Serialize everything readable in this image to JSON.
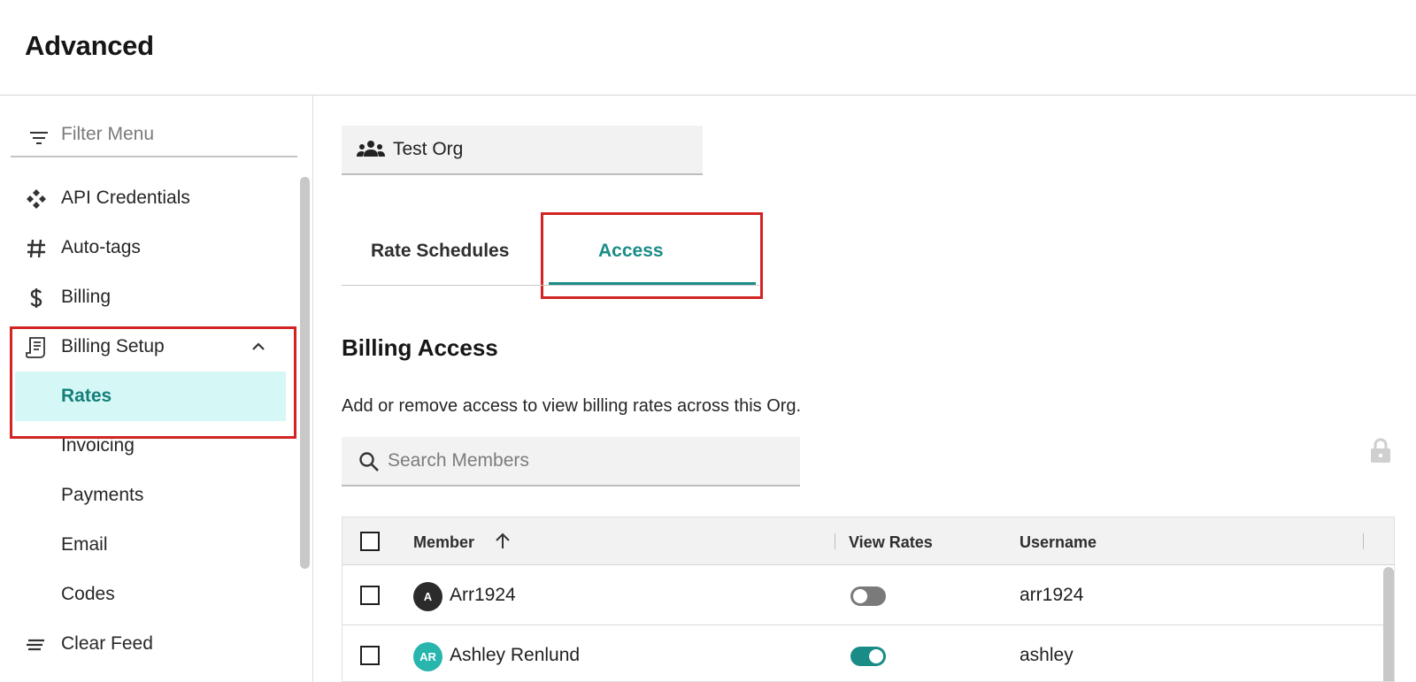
{
  "header": {
    "title": "Advanced"
  },
  "sidebar": {
    "filter_placeholder": "Filter Menu",
    "items": [
      {
        "label": "API Credentials",
        "icon": "api-icon"
      },
      {
        "label": "Auto-tags",
        "icon": "hashtag-icon"
      },
      {
        "label": "Billing",
        "icon": "dollar-icon"
      },
      {
        "label": "Billing Setup",
        "icon": "receipt-icon",
        "expanded": true
      }
    ],
    "sub_items": [
      {
        "label": "Rates",
        "active": true
      },
      {
        "label": "Invoicing"
      },
      {
        "label": "Payments"
      },
      {
        "label": "Email"
      },
      {
        "label": "Codes"
      }
    ],
    "bottom_item": {
      "label": "Clear Feed",
      "icon": "clear-feed-icon"
    }
  },
  "org": {
    "label": "Test Org",
    "icon": "group-icon"
  },
  "tabs": [
    {
      "label": "Rate Schedules",
      "active": false
    },
    {
      "label": "Access",
      "active": true
    }
  ],
  "section": {
    "title": "Billing Access",
    "description": "Add or remove access to view billing rates across this Org."
  },
  "search": {
    "placeholder": "Search Members"
  },
  "table": {
    "columns": {
      "member": "Member",
      "view_rates": "View Rates",
      "username": "Username"
    },
    "rows": [
      {
        "initials": "A",
        "avatar_color": "#2b2b2b",
        "name": "Arr1924",
        "view_rates": false,
        "username": "arr1924"
      },
      {
        "initials": "AR",
        "avatar_color": "#27b5ad",
        "name": "Ashley Renlund",
        "view_rates": true,
        "username": "ashley"
      }
    ]
  },
  "colors": {
    "accent": "#1a8c87",
    "active_bg": "#d5f8f6",
    "highlight": "#d32424"
  }
}
